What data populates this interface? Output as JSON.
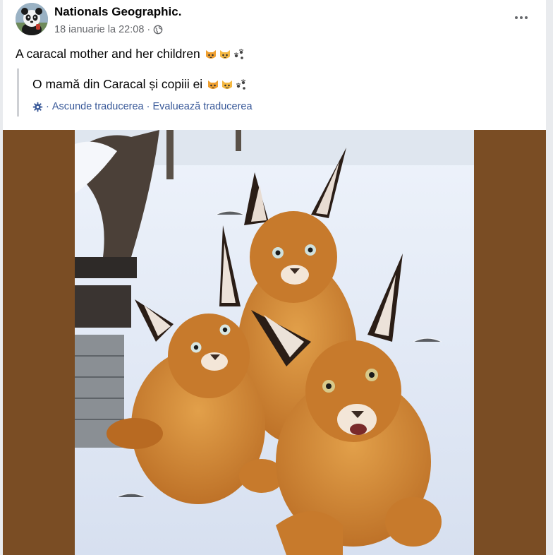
{
  "post": {
    "author": "Nationals Geographic.",
    "timestamp": "18 ianuarie la 22:08",
    "separator": "·",
    "privacy_icon": "globe-icon",
    "more_icon": "more-options-icon",
    "text": "A caracal mother and her children",
    "emojis": [
      "cat-face-emoji",
      "cat-face-emoji",
      "paw-prints-emoji"
    ]
  },
  "translation": {
    "text": "O mamă din Caracal și copiii ei",
    "settings_icon": "gear-icon",
    "hide_label": "Ascunde traducerea",
    "rate_label": "Evaluează traducerea",
    "dot": "·"
  },
  "photo": {
    "subject_icon": "caracal-photo"
  },
  "colors": {
    "link": "#385898",
    "meta": "#65676b",
    "frame_background": "#7a4d24",
    "border": "#ced0d4"
  }
}
